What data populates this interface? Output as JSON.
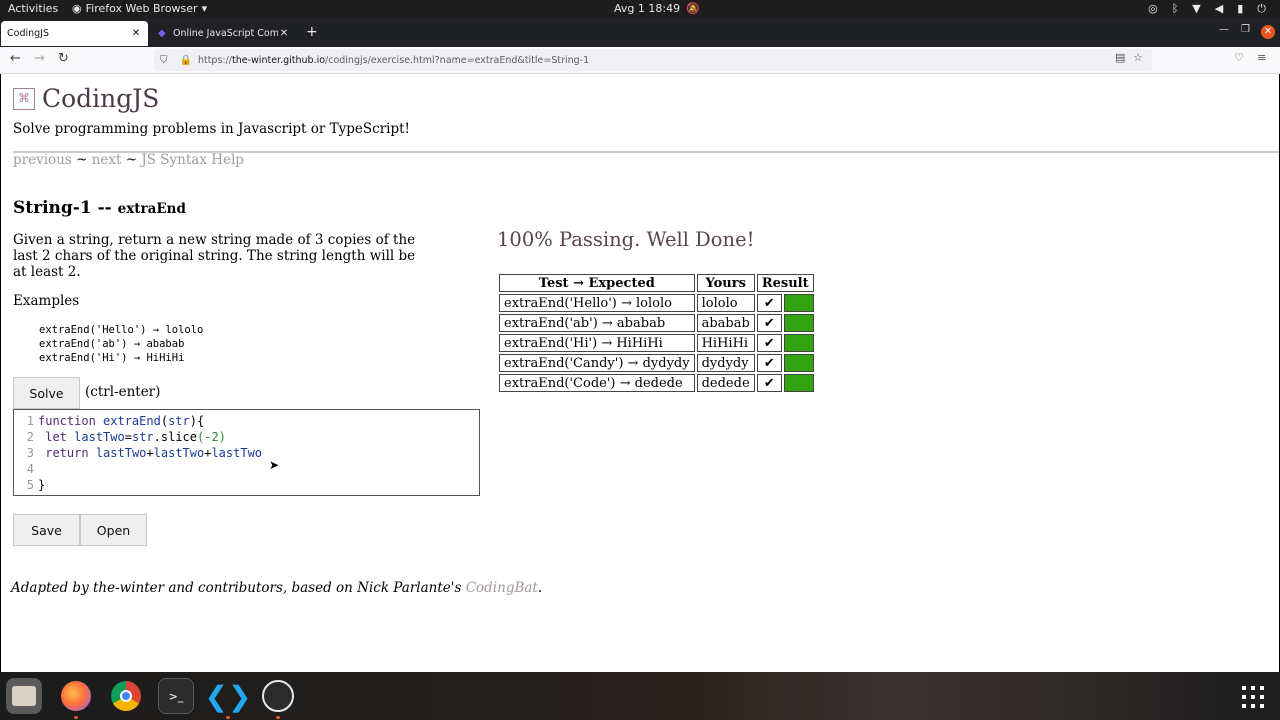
{
  "system_bar": {
    "activities": "Activities",
    "app_name": "Firefox Web Browser",
    "clock": "Avg 1  18:49"
  },
  "browser": {
    "tabs": [
      {
        "label": "CodingJS",
        "active": true
      },
      {
        "label": "Online JavaScript Compil",
        "active": false
      }
    ],
    "url_prefix": "https://",
    "url_host": "the-winter.github.io",
    "url_path": "/codingjs/exercise.html?name=extraEnd&title=String-1"
  },
  "site": {
    "logo": "CodingJS",
    "tagline": "Solve programming problems in Javascript or TypeScript!",
    "nav": {
      "previous": "previous",
      "sep1": " ~ ",
      "next": "next",
      "sep2": " ~ ",
      "help": "JS Syntax Help"
    }
  },
  "exercise": {
    "title": "String-1 -- ",
    "name": "extraEnd",
    "description": "Given a string, return a new string made of 3 copies of the last 2 chars of the original string. The string length will be at least 2.",
    "examples_label": "Examples",
    "examples": [
      "extraEnd('Hello') → lololo",
      "extraEnd('ab') → ababab",
      "extraEnd('Hi') → HiHiHi"
    ],
    "solve_label": "Solve",
    "solve_hint": "(ctrl-enter)",
    "line_numbers": [
      "1",
      "2",
      "3",
      "4",
      "5"
    ],
    "save_label": "Save",
    "open_label": "Open"
  },
  "results": {
    "headline": "100% Passing. Well Done!",
    "headers": [
      "Test → Expected",
      "Yours",
      "Result"
    ],
    "rows": [
      {
        "test": "extraEnd('Hello') → lololo",
        "yours": "lololo",
        "check": "✔"
      },
      {
        "test": "extraEnd('ab') → ababab",
        "yours": "ababab",
        "check": "✔"
      },
      {
        "test": "extraEnd('Hi') → HiHiHi",
        "yours": "HiHiHi",
        "check": "✔"
      },
      {
        "test": "extraEnd('Candy') → dydydy",
        "yours": "dydydy",
        "check": "✔"
      },
      {
        "test": "extraEnd('Code') → dedede",
        "yours": "dedede",
        "check": "✔"
      }
    ],
    "pass_color": "#33a312"
  },
  "footer": {
    "text": "Adapted by the-winter and contributors, based on Nick Parlante's ",
    "link": "CodingBat",
    "end": "."
  },
  "dock": [
    "files-icon",
    "firefox-icon",
    "chrome-icon",
    "terminal-icon",
    "vscode-icon",
    "obs-icon"
  ]
}
